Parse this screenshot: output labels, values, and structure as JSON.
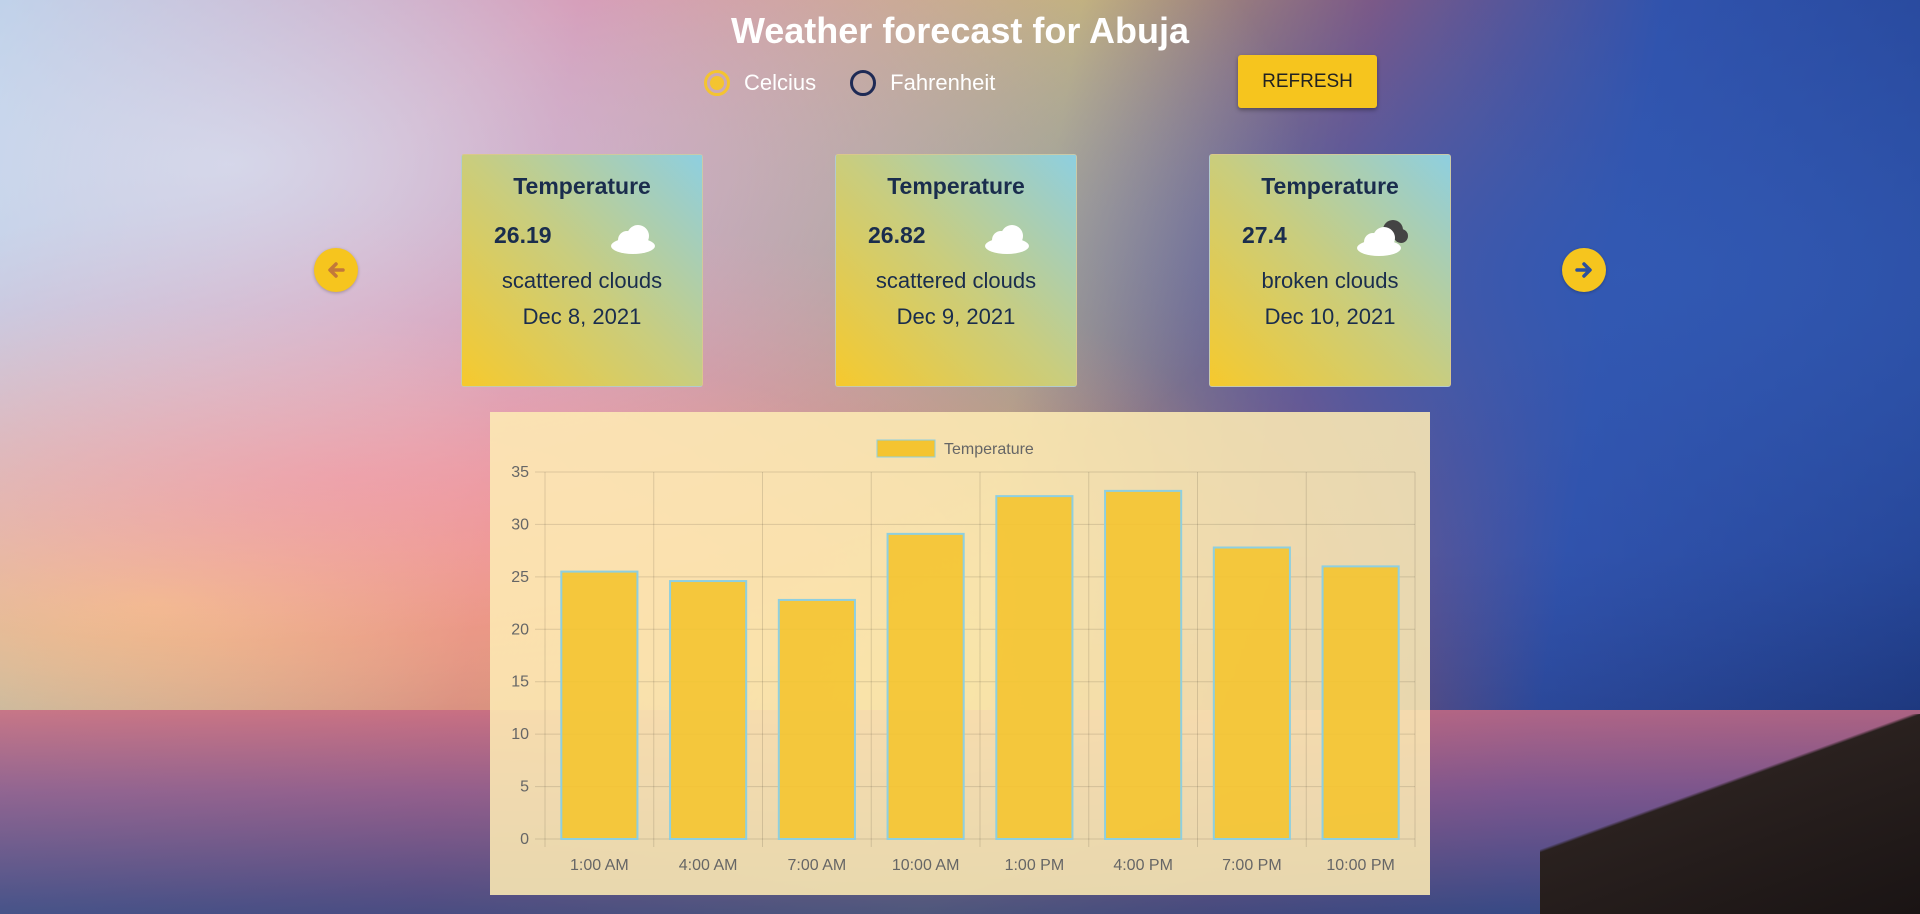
{
  "header": {
    "title": "Weather forecast for Abuja"
  },
  "units": {
    "options": [
      {
        "label": "Celcius",
        "selected": true
      },
      {
        "label": "Fahrenheit",
        "selected": false
      }
    ]
  },
  "actions": {
    "refresh_label": "REFRESH"
  },
  "cards": [
    {
      "label": "Temperature",
      "temp": "26.19",
      "icon": "scattered-clouds-icon",
      "description": "scattered clouds",
      "date": "Dec 8, 2021"
    },
    {
      "label": "Temperature",
      "temp": "26.82",
      "icon": "scattered-clouds-icon",
      "description": "scattered clouds",
      "date": "Dec 9, 2021"
    },
    {
      "label": "Temperature",
      "temp": "27.4",
      "icon": "broken-clouds-icon",
      "description": "broken clouds",
      "date": "Dec 10, 2021"
    }
  ],
  "navigation": {
    "prev_icon": "arrow-left-icon",
    "next_icon": "arrow-right-icon"
  },
  "colors": {
    "accent": "#f6c51e",
    "bar_fill": "#f4c430",
    "bar_border": "#8ecfe0",
    "title_text": "#ffffff",
    "card_text": "#1a2d4d"
  },
  "chart_data": {
    "type": "bar",
    "categories": [
      "1:00 AM",
      "4:00 AM",
      "7:00 AM",
      "10:00 AM",
      "1:00 PM",
      "4:00 PM",
      "7:00 PM",
      "10:00 PM"
    ],
    "series": [
      {
        "name": "Temperature",
        "values": [
          25.5,
          24.6,
          22.8,
          29.1,
          32.7,
          33.2,
          27.8,
          26.0
        ]
      }
    ],
    "ylim": [
      0,
      35
    ],
    "yticks": [
      0,
      5,
      10,
      15,
      20,
      25,
      30,
      35
    ],
    "grid": true,
    "legend": "top-center"
  }
}
